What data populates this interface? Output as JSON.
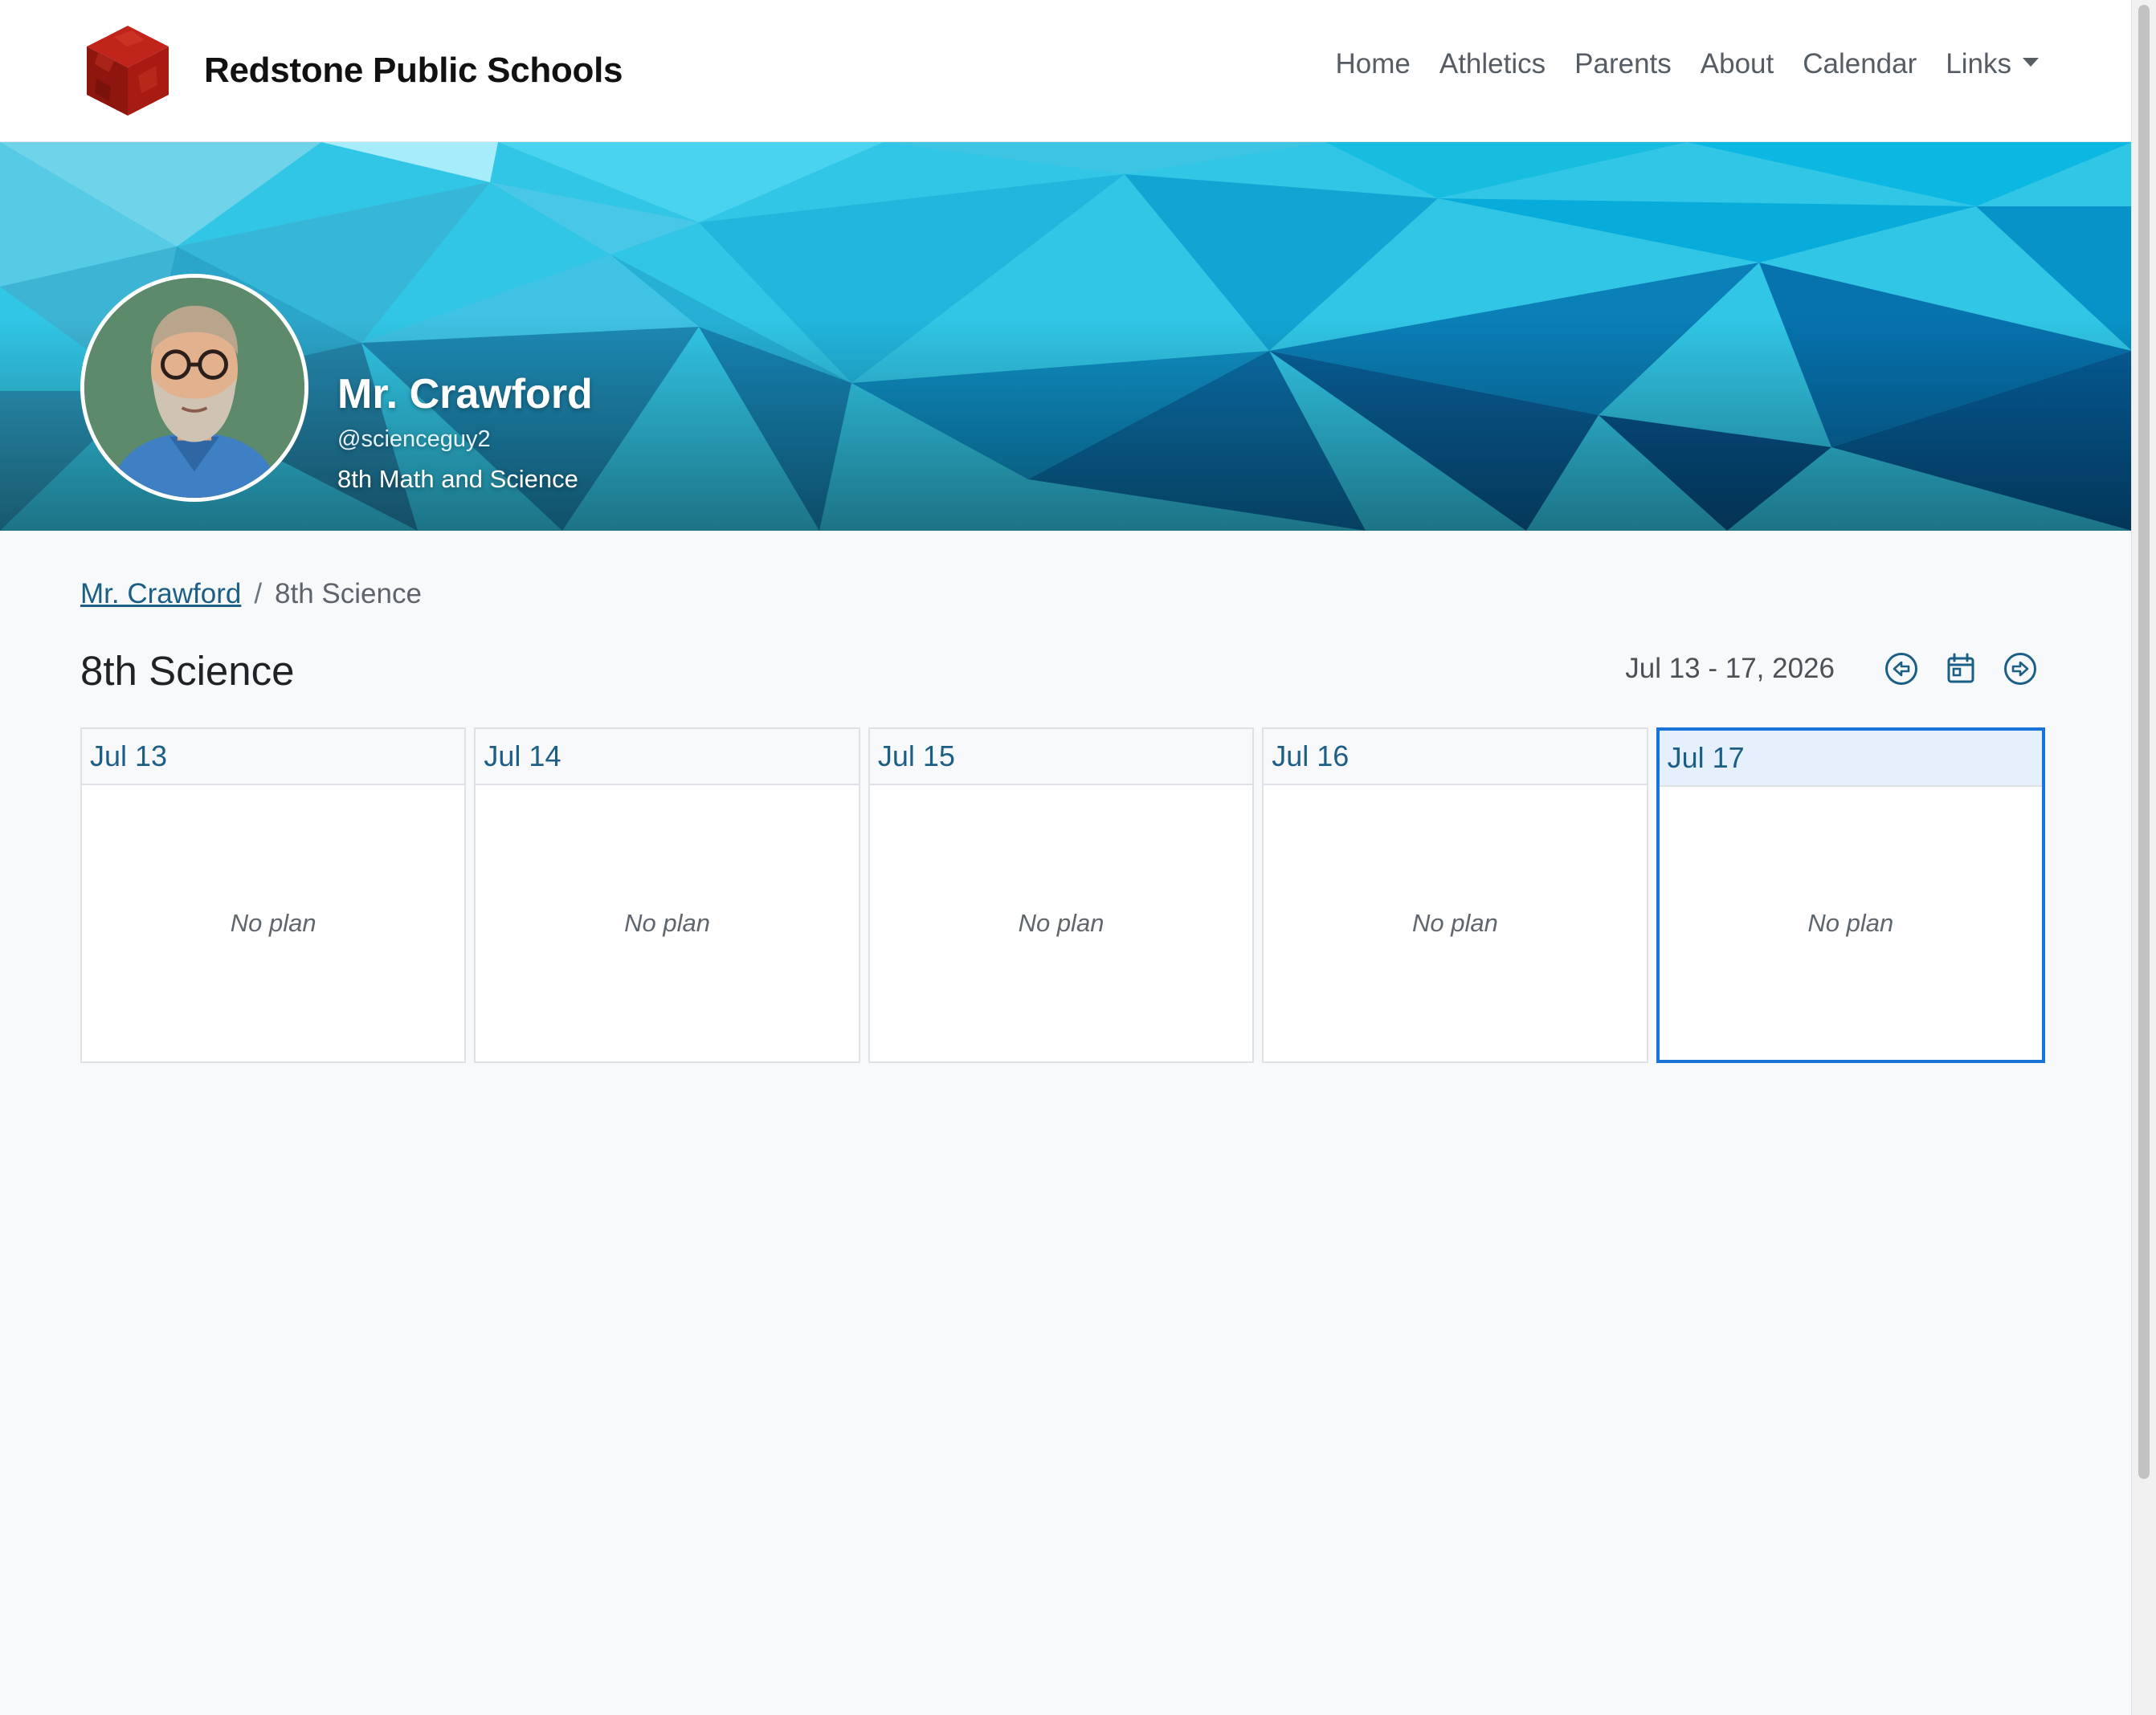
{
  "site": {
    "name": "Redstone Public Schools",
    "logo_icon": "red-cube-logo"
  },
  "nav": {
    "items": [
      "Home",
      "Athletics",
      "Parents",
      "About",
      "Calendar",
      "Links"
    ],
    "links_has_dropdown": true
  },
  "profile": {
    "name": "Mr. Crawford",
    "handle": "@scienceguy2",
    "subtitle": "8th Math and Science"
  },
  "breadcrumb": {
    "parent": "Mr. Crawford",
    "separator": "/",
    "current": "8th Science"
  },
  "page": {
    "title": "8th Science",
    "week_range": "Jul 13 - 17, 2026",
    "prev_week_icon": "arrow-left-circle-icon",
    "calendar_icon": "calendar-icon",
    "next_week_icon": "arrow-right-circle-icon"
  },
  "days": [
    {
      "label": "Jul 13",
      "plan": "No plan",
      "selected": false
    },
    {
      "label": "Jul 14",
      "plan": "No plan",
      "selected": false
    },
    {
      "label": "Jul 15",
      "plan": "No plan",
      "selected": false
    },
    {
      "label": "Jul 16",
      "plan": "No plan",
      "selected": false
    },
    {
      "label": "Jul 17",
      "plan": "No plan",
      "selected": true
    }
  ],
  "colors": {
    "link": "#1b5e86",
    "today_border": "#1a73d9",
    "today_header": "#e6f0fc",
    "hero_primary": "#00bde3",
    "page_background": "#f8f9fa"
  }
}
